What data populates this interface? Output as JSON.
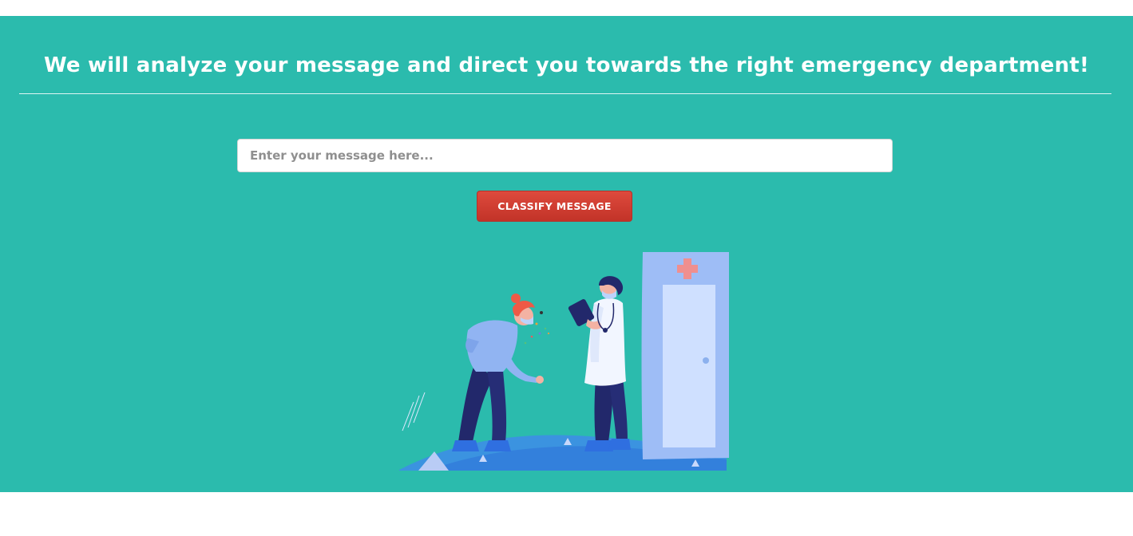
{
  "header": {
    "title": "We will analyze your message and direct you towards the right emergency department!"
  },
  "form": {
    "message_input": {
      "placeholder": "Enter your message here...",
      "value": ""
    },
    "classify_button_label": "CLASSIFY MESSAGE"
  },
  "illustration": {
    "icon": "doctor-patient-illustration"
  },
  "colors": {
    "background": "#2bbbad",
    "button": "#d13f33",
    "text_on_dark": "#ffffff"
  }
}
